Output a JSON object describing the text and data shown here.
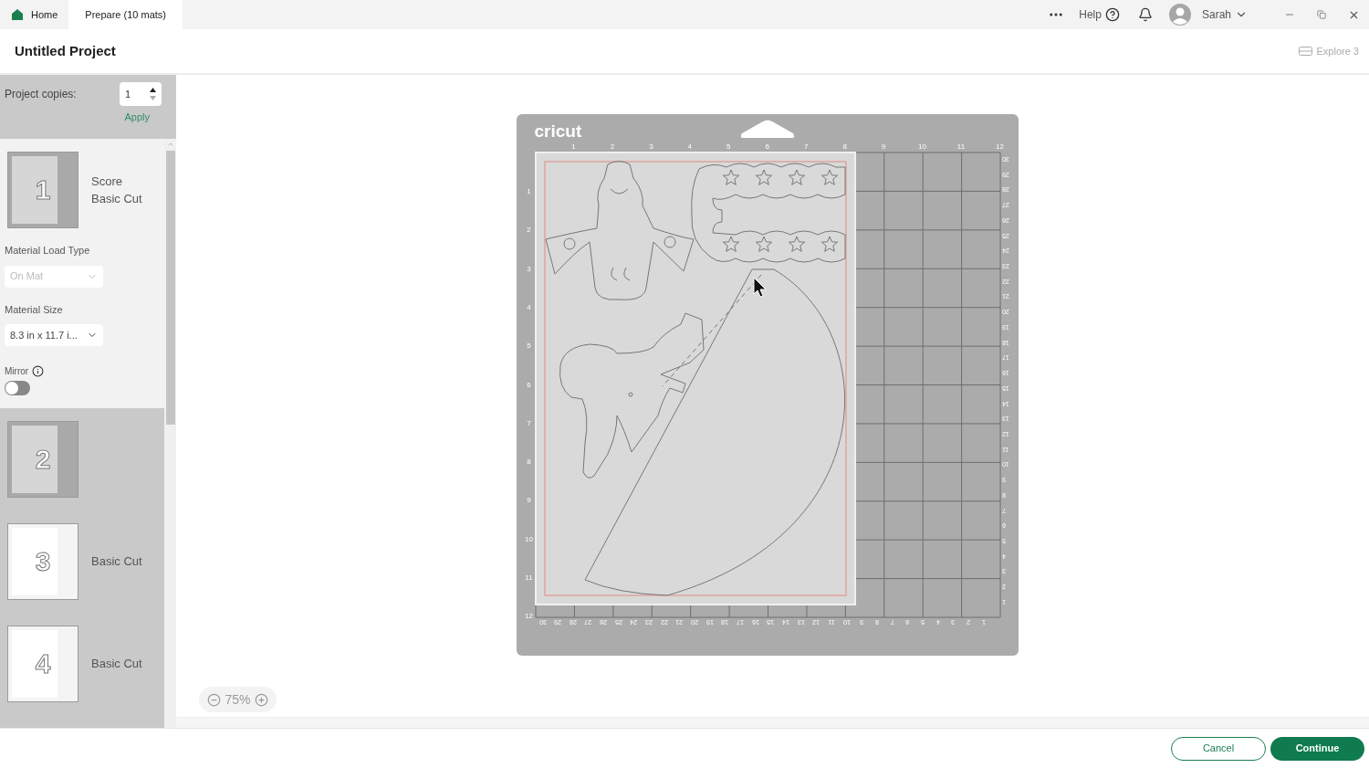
{
  "tabs": [
    {
      "label": "Home",
      "selected": false,
      "kind": "home"
    },
    {
      "label": "Prepare (10 mats)",
      "selected": true,
      "kind": "plain"
    }
  ],
  "top_bar": {
    "help": "Help",
    "user": "Sarah"
  },
  "project": {
    "title": "Untitled Project",
    "machine": "Explore 3"
  },
  "copies": {
    "label": "Project copies:",
    "value": "1",
    "apply": "Apply"
  },
  "mats": [
    {
      "number": "1",
      "operations": [
        "Score",
        "Basic Cut"
      ],
      "selected": true,
      "kind": "grid"
    },
    {
      "number": "2",
      "selected": false,
      "kind": "grid"
    },
    {
      "number": "3",
      "operations": [
        "Basic Cut"
      ],
      "selected": false,
      "kind": "paper"
    },
    {
      "number": "4",
      "operations": [
        "Basic Cut"
      ],
      "selected": false,
      "kind": "paper"
    }
  ],
  "mat_options": {
    "load_type_label": "Material Load Type",
    "load_type": "On Mat",
    "load_type_disabled": true,
    "size_label": "Material Size",
    "size": "8.3 in x 11.7 i...",
    "mirror_label": "Mirror",
    "mirror_on": false
  },
  "canvas": {
    "logo": "cricut",
    "zoom": "75%",
    "top_ruler": [
      "1",
      "2",
      "3",
      "4",
      "5",
      "6",
      "7",
      "8",
      "9",
      "10",
      "11",
      "12"
    ],
    "left_ruler": [
      "1",
      "2",
      "3",
      "4",
      "5",
      "6",
      "7",
      "8",
      "9",
      "10",
      "11",
      "12"
    ],
    "right_ruler": [
      "30",
      "29",
      "28",
      "27",
      "26",
      "25",
      "24",
      "23",
      "22",
      "21",
      "20",
      "19",
      "18",
      "17",
      "16",
      "15",
      "14",
      "13",
      "12",
      "11",
      "10",
      "9",
      "8",
      "7",
      "6",
      "5",
      "4",
      "3",
      "2",
      "1"
    ],
    "bottom_ruler": [
      "30",
      "29",
      "28",
      "27",
      "26",
      "25",
      "24",
      "23",
      "22",
      "21",
      "20",
      "19",
      "18",
      "17",
      "16",
      "15",
      "14",
      "13",
      "12",
      "11",
      "10",
      "9",
      "8",
      "7",
      "6",
      "5",
      "4",
      "3",
      "2",
      "1"
    ]
  },
  "buttons": {
    "cancel": "Cancel",
    "continue": "Continue"
  }
}
